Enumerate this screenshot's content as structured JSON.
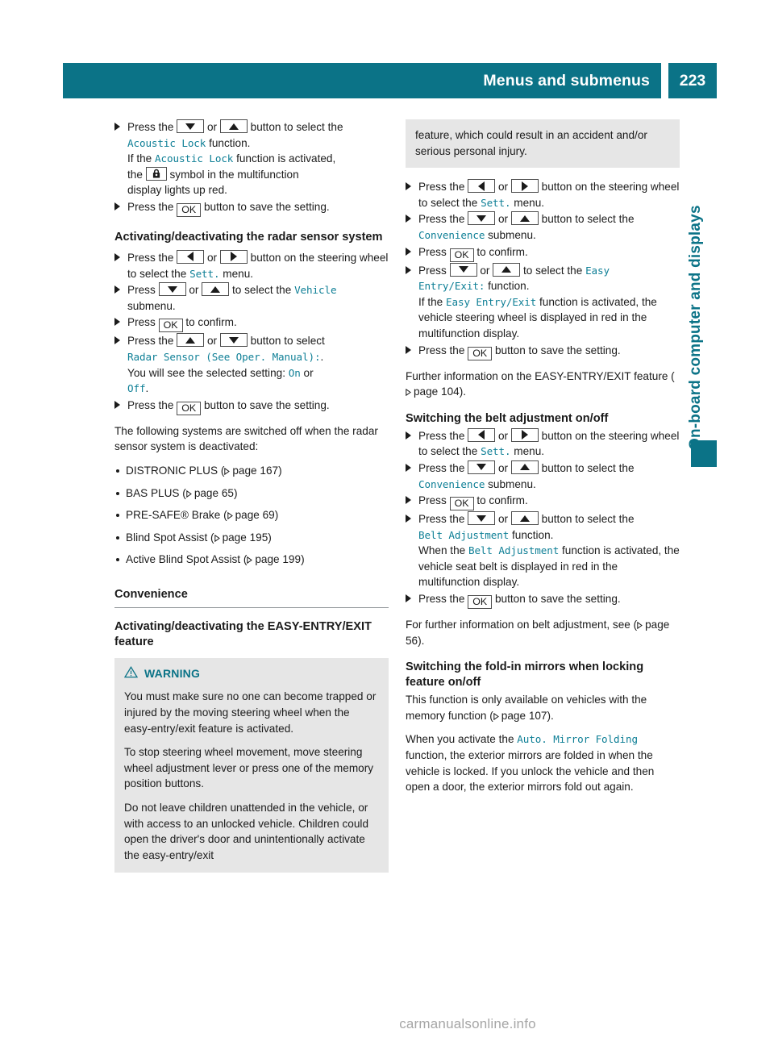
{
  "page": {
    "header_title": "Menus and submenus",
    "page_number": "223",
    "side_tab": "On-board computer and displays",
    "watermark": "carmanualsonline.info",
    "accent_color": "#0b7387",
    "menu_text_color": "#0e7f96",
    "warning_box_color": "#e6e6e6"
  },
  "left_column": {
    "acoustic_lock_steps": [
      {
        "lead": "Press the",
        "key1": "down-arrow-key",
        "or": "or",
        "key2": "up-arrow-key",
        "tail": "button to select the",
        "menu": "Acoustic Lock",
        "tail2": "function.",
        "note_a": "If the",
        "note_menu": "Acoustic Lock",
        "note_b": "function is activated,",
        "note_c": "the",
        "note_key": "lock-symbol-key",
        "note_d": "symbol in the multifunction",
        "note_e": "display lights up red."
      },
      {
        "lead": "Press the",
        "key": "OK",
        "tail": "button to save the setting."
      }
    ],
    "radar_heading": "Activating/deactivating the radar sensor system",
    "radar_steps": [
      {
        "lead": "Press the",
        "key1": "left-arrow-key",
        "or": "or",
        "key2": "right-arrow-key",
        "tail": "button on the steering wheel to select the",
        "menu": "Sett.",
        "tail2": "menu."
      },
      {
        "lead": "Press",
        "key1": "down-arrow-key",
        "or": "or",
        "key2": "up-arrow-key",
        "tail": "to select the",
        "menu": "Vehicle",
        "tail2": "submenu."
      },
      {
        "lead": "Press",
        "key": "OK",
        "tail": "to confirm."
      },
      {
        "lead": "Press the",
        "key1": "up-arrow-key",
        "or": "or",
        "key2": "down-arrow-key",
        "tail": "button to select",
        "menu": "Radar Sensor (See Oper. Manual):",
        "tail2": ".",
        "note_a": "You will see the selected setting:",
        "note_on": "On",
        "note_or": "or",
        "note_off": "Off",
        "note_end": "."
      },
      {
        "lead": "Press the",
        "key": "OK",
        "tail": "button to save the setting."
      }
    ],
    "radar_note": "The following systems are switched off when the radar sensor system is deactivated:",
    "radar_list": [
      {
        "label": "DISTRONIC PLUS",
        "page_label": "page 167"
      },
      {
        "label": "BAS PLUS",
        "page_label": "page 65"
      },
      {
        "label": "PRE-SAFE® Brake",
        "page_label": "page 69"
      },
      {
        "label": "Blind Spot Assist",
        "page_label": "page 195"
      },
      {
        "label": "Active Blind Spot Assist",
        "page_label": "page 199"
      }
    ],
    "convenience_heading": "Convenience",
    "easy_entry_heading": "Activating/deactivating the EASY-ENTRY/EXIT feature",
    "warning": {
      "title": "WARNING",
      "icon": "warning-triangle-icon",
      "paragraphs": [
        "You must make sure no one can become trapped or injured by the moving steering wheel when the easy-entry/exit feature is activated.",
        "To stop steering wheel movement, move steering wheel adjustment lever or press one of the memory position buttons.",
        "Do not leave children unattended in the vehicle, or with access to an unlocked vehicle. Children could open the driver's door and unintentionally activate the easy-entry/exit"
      ]
    }
  },
  "right_column": {
    "warning_continued": "feature, which could result in an accident and/or serious personal injury.",
    "easy_entry_steps": [
      {
        "lead": "Press the",
        "key1": "left-arrow-key",
        "or": "or",
        "key2": "right-arrow-key",
        "tail": "button on the steering wheel to select the",
        "menu": "Sett.",
        "tail2": "menu."
      },
      {
        "lead": "Press the",
        "key1": "down-arrow-key",
        "or": "or",
        "key2": "up-arrow-key",
        "tail": "button to select the",
        "menu": "Convenience",
        "tail2": "submenu."
      },
      {
        "lead": "Press",
        "key": "OK",
        "tail": "to confirm."
      },
      {
        "lead": "Press",
        "key1": "down-arrow-key",
        "or": "or",
        "key2": "up-arrow-key",
        "tail": "to select the",
        "menu": "Easy Entry/Exit:",
        "tail2": "function.",
        "note_a": "If the",
        "note_menu": "Easy Entry/Exit",
        "note_b": "function is activated, the vehicle steering wheel is displayed in red in the multifunction display."
      },
      {
        "lead": "Press the",
        "key": "OK",
        "tail": "button to save the setting."
      }
    ],
    "easy_entry_note_a": "Further information on the EASY-ENTRY/EXIT feature (",
    "easy_entry_note_page": "page 104",
    "easy_entry_note_b": ").",
    "belt_heading": "Switching the belt adjustment on/off",
    "belt_steps": [
      {
        "lead": "Press the",
        "key1": "left-arrow-key",
        "or": "or",
        "key2": "right-arrow-key",
        "tail": "button on the steering wheel to select the",
        "menu": "Sett.",
        "tail2": "menu."
      },
      {
        "lead": "Press the",
        "key1": "down-arrow-key",
        "or": "or",
        "key2": "up-arrow-key",
        "tail": "button to select the",
        "menu": "Convenience",
        "tail2": "submenu."
      },
      {
        "lead": "Press",
        "key": "OK",
        "tail": "to confirm."
      },
      {
        "lead": "Press the",
        "key1": "down-arrow-key",
        "or": "or",
        "key2": "up-arrow-key",
        "tail": "button to select the",
        "menu": "Belt Adjustment",
        "tail2": "function.",
        "note_a": "When the",
        "note_menu": "Belt Adjustment",
        "note_b": "function is activated, the vehicle seat belt is displayed in red in the multifunction display."
      },
      {
        "lead": "Press the",
        "key": "OK",
        "tail": "button to save the setting."
      }
    ],
    "belt_note_a": "For further information on belt adjustment, see (",
    "belt_note_page": "page 56",
    "belt_note_b": ").",
    "mirror_heading": "Switching the fold-in mirrors when locking feature on/off",
    "mirror_note_a": "This function is only available on vehicles with the memory function (",
    "mirror_note_page": "page 107",
    "mirror_note_b": ").",
    "mirror_para_a": "When you activate the",
    "mirror_menu": "Auto. Mirror Folding",
    "mirror_para_b": "function, the exterior mirrors are folded in when the vehicle is locked. If you unlock the vehicle and then open a door, the exterior mirrors fold out again."
  }
}
